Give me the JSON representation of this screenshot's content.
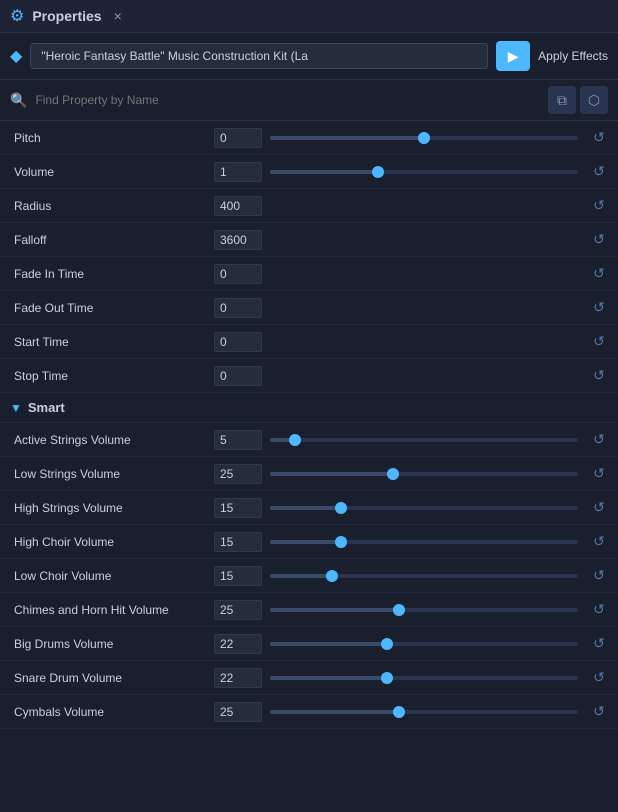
{
  "titleBar": {
    "icon": "⚙",
    "label": "Properties",
    "closeLabel": "×"
  },
  "headerBar": {
    "assetIcon": "◆",
    "assetName": "\"Heroic Fantasy Battle\" Music Construction Kit (La",
    "playIcon": "▶",
    "applyEffectsLabel": "Apply Effects",
    "copyIcon": "⧉",
    "pasteIcon": "⬡"
  },
  "searchBar": {
    "searchIcon": "🔍",
    "placeholder": "Find Property by Name"
  },
  "properties": [
    {
      "label": "Pitch",
      "value": "0",
      "sliderPct": 50,
      "hasSlider": true
    },
    {
      "label": "Volume",
      "value": "1",
      "sliderPct": 35,
      "hasSlider": true
    },
    {
      "label": "Radius",
      "value": "400",
      "sliderPct": 0,
      "hasSlider": false
    },
    {
      "label": "Falloff",
      "value": "3600",
      "sliderPct": 0,
      "hasSlider": false
    },
    {
      "label": "Fade In Time",
      "value": "0",
      "sliderPct": 0,
      "hasSlider": false
    },
    {
      "label": "Fade Out Time",
      "value": "0",
      "sliderPct": 0,
      "hasSlider": false
    },
    {
      "label": "Start Time",
      "value": "0",
      "sliderPct": 0,
      "hasSlider": false
    },
    {
      "label": "Stop Time",
      "value": "0",
      "sliderPct": 0,
      "hasSlider": false
    }
  ],
  "smartSection": {
    "label": "Smart",
    "properties": [
      {
        "label": "Active Strings Volume",
        "value": "5",
        "sliderPct": 8
      },
      {
        "label": "Low Strings Volume",
        "value": "25",
        "sliderPct": 40
      },
      {
        "label": "High Strings Volume",
        "value": "15",
        "sliderPct": 23
      },
      {
        "label": "High Choir Volume",
        "value": "15",
        "sliderPct": 23
      },
      {
        "label": "Low Choir Volume",
        "value": "15",
        "sliderPct": 20
      },
      {
        "label": "Chimes and Horn Hit Volume",
        "value": "25",
        "sliderPct": 42
      },
      {
        "label": "Big Drums Volume",
        "value": "22",
        "sliderPct": 38
      },
      {
        "label": "Snare Drum Volume",
        "value": "22",
        "sliderPct": 38
      },
      {
        "label": "Cymbals Volume",
        "value": "25",
        "sliderPct": 42
      }
    ]
  },
  "resetIcon": "↺"
}
